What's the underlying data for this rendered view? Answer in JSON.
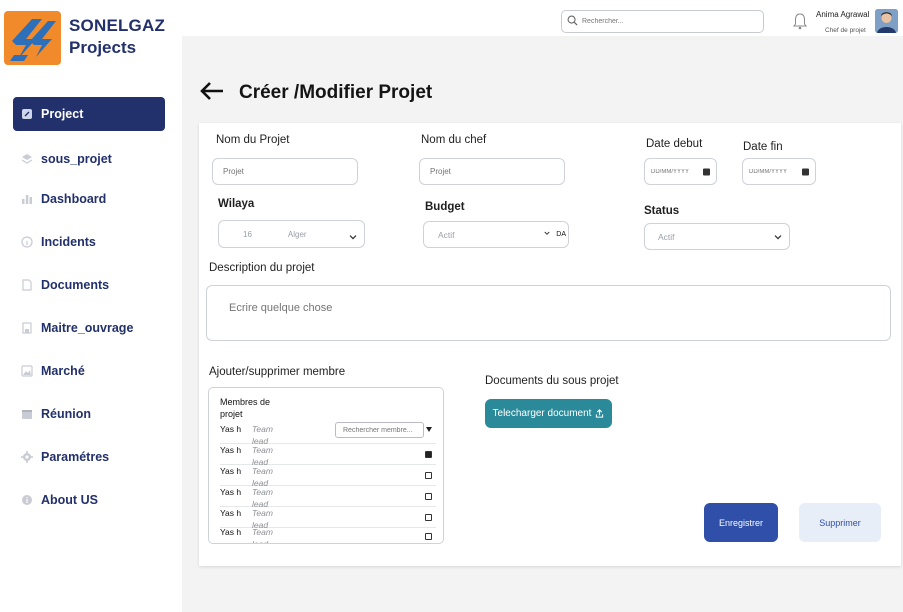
{
  "app": {
    "brand_line1": "SONELGAZ",
    "brand_line2": "Projects"
  },
  "sidebar": {
    "items": [
      {
        "label": "Project",
        "icon": "edit-icon",
        "active": true
      },
      {
        "label": "sous_projet",
        "icon": "layers-icon",
        "active": false
      },
      {
        "label": "Dashboard",
        "icon": "bar-chart-icon",
        "active": false
      },
      {
        "label": "Incidents",
        "icon": "info-icon",
        "active": false
      },
      {
        "label": "Documents",
        "icon": "document-icon",
        "active": false
      },
      {
        "label": "Maitre_ouvrage",
        "icon": "building-icon",
        "active": false
      },
      {
        "label": "Marché",
        "icon": "image-icon",
        "active": false
      },
      {
        "label": "Réunion",
        "icon": "calendar-icon",
        "active": false
      },
      {
        "label": "Paramétres",
        "icon": "gear-icon",
        "active": false
      },
      {
        "label": "About US",
        "icon": "info-icon",
        "active": false
      }
    ]
  },
  "topbar": {
    "search_placeholder": "Rechercher...",
    "user_name": "Anima Agrawal",
    "user_role": "Chef de projet"
  },
  "page": {
    "title": "Créer /Modifier Projet"
  },
  "form": {
    "nom_projet_label": "Nom du Projet",
    "nom_projet_placeholder": "Projet",
    "nom_chef_label": "Nom du chef",
    "nom_chef_placeholder": "Projet",
    "date_debut_label": "Date debut",
    "date_debut_placeholder": "DD/MM/YYYY",
    "date_fin_label": "Date fin",
    "date_fin_placeholder": "DD/MM/YYYY",
    "wilaya_label": "Wilaya",
    "wilaya_code": "16",
    "wilaya_value": "Alger",
    "budget_label": "Budget",
    "budget_value": "Actif",
    "budget_unit": "DA",
    "status_label": "Status",
    "status_value": "Actif",
    "description_label": "Description du projet",
    "description_placeholder": "Ecrire quelque chose",
    "members_label": "Ajouter/supprimer membre",
    "members_title": "Membres de projet",
    "members_search_placeholder": "Rechercher membre...",
    "members": [
      {
        "name": "Yas h",
        "role": "Team lead",
        "checked": false
      },
      {
        "name": "Yas h",
        "role": "Team lead",
        "checked": true
      },
      {
        "name": "Yas h",
        "role": "Team lead",
        "checked": false
      },
      {
        "name": "Yas h",
        "role": "Team lead",
        "checked": false
      },
      {
        "name": "Yas h",
        "role": "Team lead",
        "checked": false
      },
      {
        "name": "Yas h",
        "role": "Team lead",
        "checked": false
      }
    ],
    "documents_label": "Documents du sous projet",
    "upload_label": "Telecharger document",
    "save_label": "Enregistrer",
    "delete_label": "Supprimer"
  },
  "colors": {
    "brand_navy": "#22306b",
    "brand_orange": "#f08a2a",
    "upload_teal": "#2a8a9a",
    "save_blue": "#2f4fa8",
    "delete_bg": "#e8eef7"
  }
}
